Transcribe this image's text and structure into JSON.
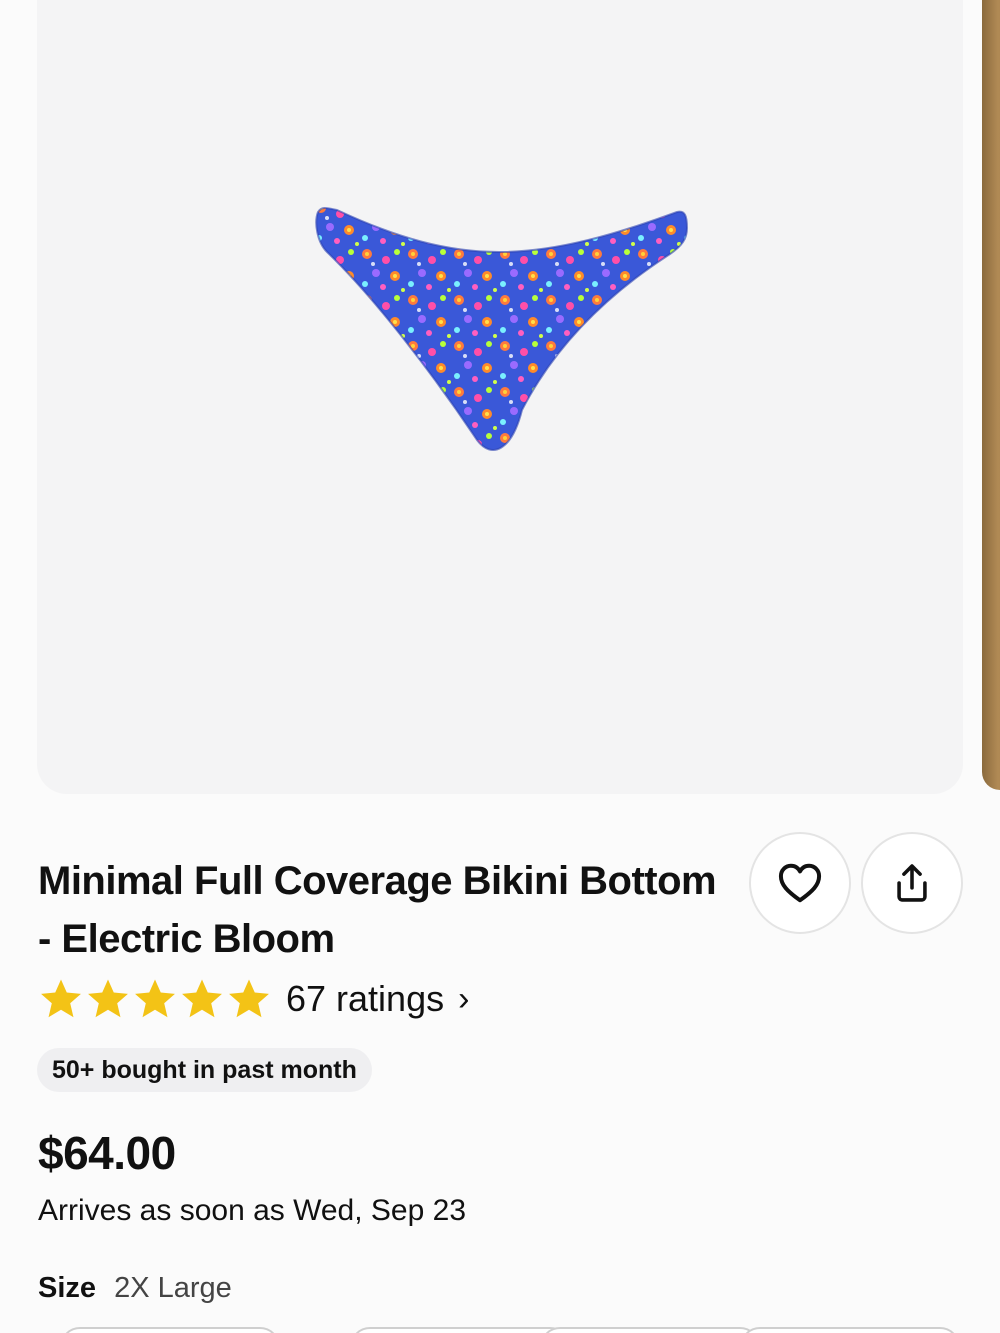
{
  "product": {
    "title": "Minimal Full Coverage Bikini Bottom - Electric Bloom",
    "image_alt": "Bikini bottom in blue floral Electric Bloom print",
    "rating": {
      "stars": 5,
      "label": "67 ratings",
      "chevron": "›"
    },
    "badge": "50+ bought in past month",
    "price": "$64.00",
    "delivery": "Arrives as soon as Wed, Sep 23",
    "size": {
      "label": "Size",
      "value": "2X Large"
    }
  },
  "actions": {
    "favorite_icon": "heart-icon",
    "share_icon": "share-icon"
  },
  "colors": {
    "star": "#f3c316",
    "fabric_base": "#3a58d8"
  }
}
